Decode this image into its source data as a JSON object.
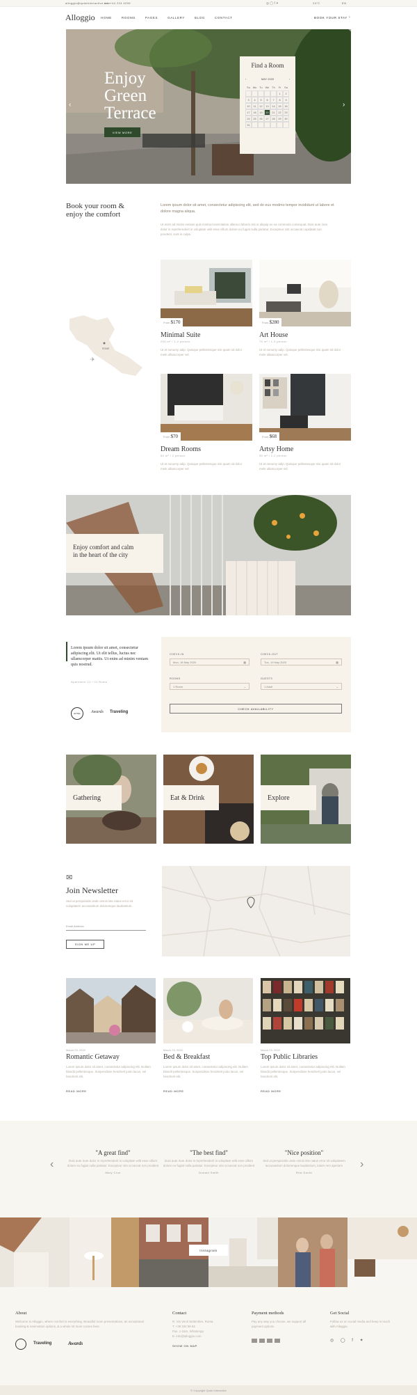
{
  "topbar": {
    "email": "alloggio@qodeinteractive.com",
    "phone": "tel. +44 224 4299",
    "temp": "24°C",
    "lang": "EN"
  },
  "nav": {
    "logo": "Alloggio",
    "links": [
      "HOME",
      "ROOMS",
      "PAGES",
      "GALLERY",
      "BLOG",
      "CONTACT"
    ],
    "cta": "BOOK YOUR STAY"
  },
  "hero": {
    "title_lines": [
      "Enjoy",
      "Green",
      "Terrace"
    ],
    "button": "VIEW MORE",
    "finder": {
      "title": "Find a Room",
      "month": "MAY 2020",
      "weekdays": [
        "Su",
        "Mo",
        "Tu",
        "We",
        "Th",
        "Fr",
        "Sa"
      ],
      "days": [
        "",
        "",
        "",
        "",
        "",
        "1",
        "2",
        "3",
        "4",
        "5",
        "6",
        "7",
        "8",
        "9",
        "10",
        "11",
        "12",
        "13",
        "14",
        "15",
        "16",
        "17",
        "18",
        "19",
        "20",
        "21",
        "22",
        "23",
        "24",
        "25",
        "26",
        "27",
        "28",
        "29",
        "30",
        "31",
        "",
        "",
        "",
        "",
        "",
        ""
      ],
      "selected": "20"
    }
  },
  "intro": {
    "heading_line1": "Book your room &",
    "heading_line2": "enjoy the comfort",
    "lead": "Lorem ipsum dolor sit amet, consectetur adipiscing elit, sed do eus modmo tempor incididunt ut labore et dolore magna aliqua.",
    "body": "Ut enim ad minim veniam quis nostrud exercitation ullamco laboris nisi ut aliquip ex ea commodo consequat. Duis aute irure dolor in reprehenderit in voluptate velit esse cillum dolore eu fugiat nulla pariatur. Excepteur sint occaecat cupidatat non proident, sunt in culpa."
  },
  "map_label": "ROME",
  "rooms": [
    {
      "name": "Minimal Suite",
      "price": "$170",
      "from": "From",
      "meta": "200 m² / 1-2 person",
      "desc": "Ut et nonumy adip. Quisque pellentesque nisi quam sit dolor mele ullamcorper vel."
    },
    {
      "name": "Art House",
      "price": "$280",
      "from": "From",
      "meta": "70 m² / 1-3 person",
      "desc": "Ut et nonumy adip. Quisque pellentesque nisi quam sit dolor mele ullamcorper vel."
    },
    {
      "name": "Dream Rooms",
      "price": "$70",
      "from": "From",
      "meta": "50 m² / 2 person",
      "desc": "Ut et nonumy adip. Quisque pellentesque nisi quam sit dolor mele ullamcorper vel."
    },
    {
      "name": "Artsy Home",
      "price": "$68",
      "from": "From",
      "meta": "30 m² / 1-2 person",
      "desc": "Ut et nonumy adip. Quisque pellentesque nisi quam sit dolor mele ullamcorper vel."
    }
  ],
  "banner": {
    "line1": "Enjoy comfort and calm",
    "line2": "in the heart of the city"
  },
  "quote": {
    "text": "Lorem ipsum dolor sit amet, consectetur adipiscing elit. Ut elit tellus, luctus nec ullamcorper mattis. Ut enim ad minim veniam quis nostrud.",
    "author": "Apartment 12 / 01 Rome",
    "badges": [
      "HOTEL",
      "Awards",
      "Traveling"
    ]
  },
  "booking": {
    "checkin_label": "CHECK-IN",
    "checkin_value": "Mon, 18 May 2020",
    "checkout_label": "CHECK-OUT",
    "checkout_value": "Tue, 19 May 2020",
    "rooms_label": "ROOMS",
    "rooms_value": "1 Room",
    "guests_label": "GUESTS",
    "guests_value": "1 Adult",
    "button": "CHECK AVAILABILITY"
  },
  "categories": [
    "Gathering",
    "Eat & Drink",
    "Explore"
  ],
  "newsletter": {
    "title": "Join Newsletter",
    "text": "Sed ut perspiciatis unde omnis iste natus error sit voluptatem accusantium doloremque laudantium.",
    "placeholder": "Email Address",
    "button": "SIGN ME UP"
  },
  "blog": [
    {
      "date": "March 23, 2020",
      "title": "Romantic Getaway",
      "text": "Lorem ipsum dolor sit amet, consectetur adipiscing elit. Nullam blandit pellentesque. Suspendisse hendrerit justo lacus, vel hendrerit elit.",
      "more": "READ MORE"
    },
    {
      "date": "March 23, 2020",
      "title": "Bed & Breakfast",
      "text": "Lorem ipsum dolor sit amet, consectetur adipiscing elit. Nullam blandit pellentesque. Suspendisse hendrerit justo lacus, vel hendrerit elit.",
      "more": "READ MORE"
    },
    {
      "date": "March 23, 2020",
      "title": "Top Public Libraries",
      "text": "Lorem ipsum dolor sit amet, consectetur adipiscing elit. Nullam blandit pellentesque. Suspendisse hendrerit justo lacus, vel hendrerit elit.",
      "more": "READ MORE"
    }
  ],
  "testimonials": [
    {
      "title": "\"A great find\"",
      "text": "Duis aute irure dolor in reprehenderit in voluptate velit esse cillum dolore eu fugiat nulla pariatur. Excepteur sint occaecat non proident",
      "name": "Mary Cruz"
    },
    {
      "title": "\"The best find\"",
      "text": "Duis aute irure dolor in reprehenderit in voluptate velit esse cillum dolore eu fugiat nulla pariatur. Excepteur sint occaecat non proident",
      "name": "Donald Smith"
    },
    {
      "title": "\"Nice position\"",
      "text": "Sed ut perspiciatis unde omnis iste natus error sit voluptatem accusantium doloremque laudantium, totam rem aperiam",
      "name": "Rita Gould"
    }
  ],
  "gallery_label": "Instagram",
  "footer": {
    "about_title": "About",
    "about_text": "Welcome to Alloggio, where comfort is everything. Beautiful room presentations, an exceptional booking & reservation options, & a whole lot more comes here.",
    "contact_title": "Contact",
    "contact_lines": [
      "R. Via Venti Settembre, Roma",
      "T. +39 334 99 82",
      "Fax. 1-2am, WhatsApp",
      "E. info@alloggio.com"
    ],
    "map_link": "SHOW ON MAP",
    "payment_title": "Payment methods",
    "payment_text": "Pay any way you choose, we support all payment options.",
    "social_title": "Get Social",
    "social_text": "Follow us on social media and keep in touch with Alloggio.",
    "copyright": "© Copyright Qode Interactive"
  },
  "colors": {
    "accent": "#2f4a2b",
    "beige": "#f7f2ea",
    "footer": "#f8f6f1"
  }
}
